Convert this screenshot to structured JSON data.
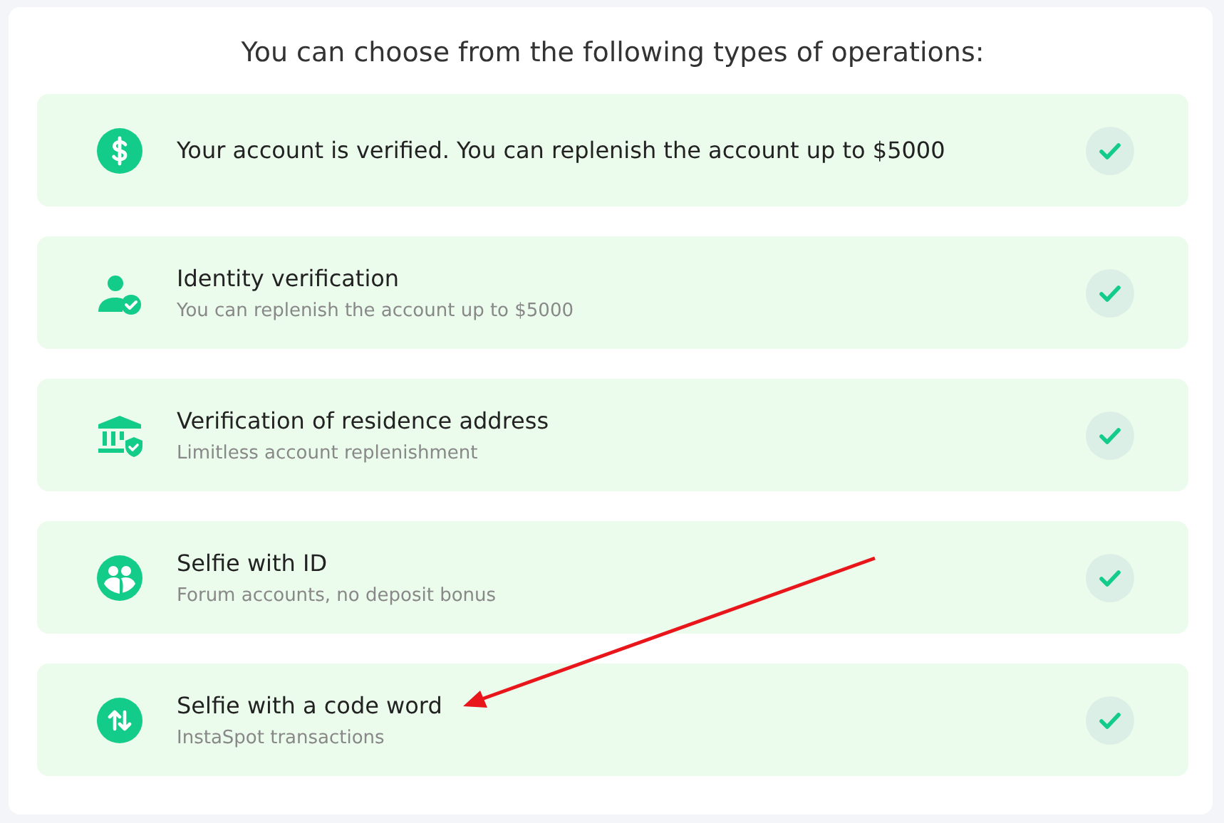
{
  "heading": "You can choose from the following types of operations:",
  "operations": [
    {
      "kind": "dollar",
      "title": "Your account is verified. You can replenish the account up to $5000",
      "verified": true
    },
    {
      "kind": "user-check",
      "title": "Identity verification",
      "subtitle": "You can replenish the account up to $5000",
      "verified": true
    },
    {
      "kind": "bank",
      "title": "Verification of residence address",
      "subtitle": "Limitless account replenishment",
      "verified": true
    },
    {
      "kind": "selfie",
      "title": "Selfie with ID",
      "subtitle": "Forum accounts, no deposit bonus",
      "verified": true
    },
    {
      "kind": "transfer",
      "title": "Selfie with a code word",
      "subtitle": "InstaSpot transactions",
      "verified": true
    }
  ]
}
